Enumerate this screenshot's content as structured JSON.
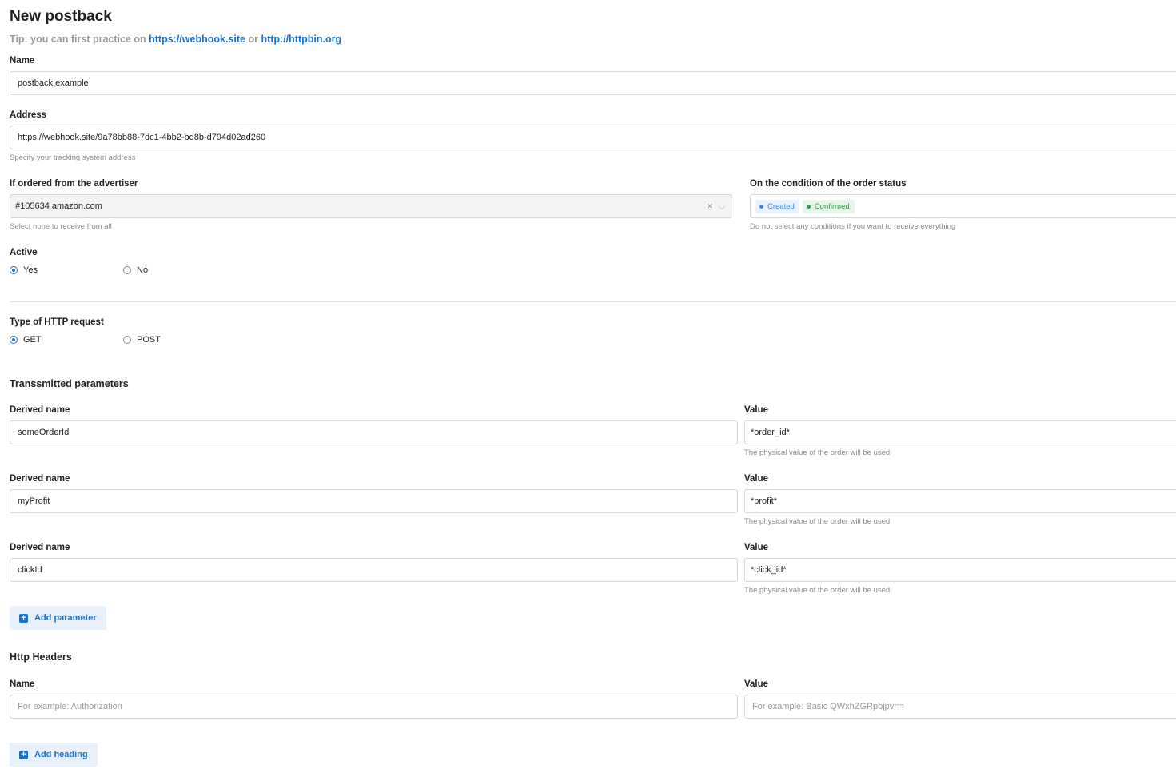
{
  "page": {
    "title": "New postback",
    "tip_prefix": "Tip: you can first practice on",
    "tip_link1": "https://webhook.site",
    "tip_or": "or",
    "tip_link2": "http://httpbin.org"
  },
  "name_field": {
    "label": "Name",
    "value": "postback example"
  },
  "address_field": {
    "label": "Address",
    "value": "https://webhook.site/9a78bb88-7dc1-4bb2-bd8b-d794d02ad260",
    "hint": "Specify your tracking system address"
  },
  "advertiser": {
    "label": "If ordered from the advertiser",
    "selected": "#105634 amazon.com",
    "clear_icon": "×",
    "chevron_icon": "⌵",
    "hint": "Select none to receive from all"
  },
  "order_status": {
    "label": "On the condition of the order status",
    "chips": [
      {
        "label": "Created",
        "color": "#3a8ad9"
      },
      {
        "label": "Confirmed",
        "color": "#2f9e44"
      }
    ],
    "hint": "Do not select any conditions if you want to receive everything"
  },
  "active": {
    "label": "Active",
    "options": [
      "Yes",
      "No"
    ],
    "selected": "Yes"
  },
  "http_type": {
    "label": "Type of HTTP request",
    "options": [
      "GET",
      "POST"
    ],
    "selected": "GET"
  },
  "params": {
    "section_title": "Transsmitted parameters",
    "name_label": "Derived name",
    "value_label": "Value",
    "value_hint": "The physical value of the order will be used",
    "rows": [
      {
        "name": "someOrderId",
        "value": "*order_id*"
      },
      {
        "name": "myProfit",
        "value": "*profit*"
      },
      {
        "name": "clickId",
        "value": "*click_id*"
      }
    ],
    "add_button": "Add parameter"
  },
  "headers": {
    "section_title": "Http Headers",
    "name_label": "Name",
    "value_label": "Value",
    "name_placeholder": "For example: Authorization",
    "value_placeholder": "For example: Basic QWxhZGRpbjpv==",
    "add_button": "Add heading"
  },
  "colors": {
    "accent": "#1f6fc5",
    "button_bg": "#e8f1fb",
    "created": "#3a8ad9",
    "confirmed": "#2f9e44"
  }
}
